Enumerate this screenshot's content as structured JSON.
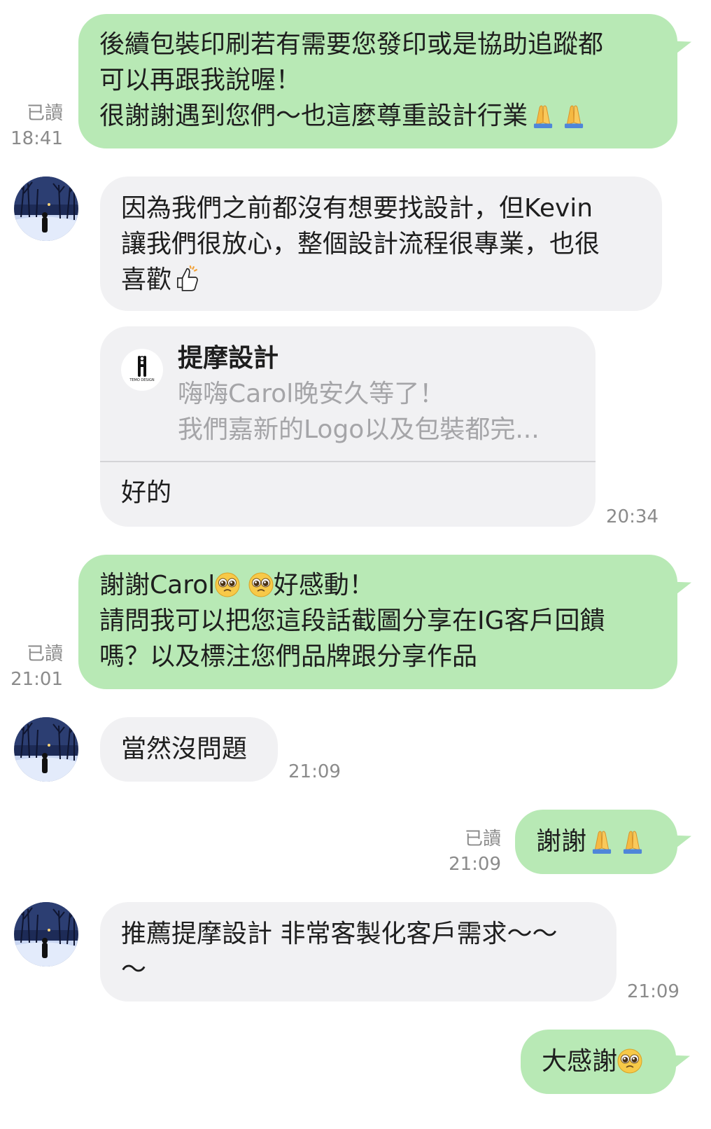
{
  "messages": [
    {
      "id": "m1",
      "lines": [
        "後續包裝印刷若有需要您發印或是協助追蹤都",
        "可以再跟我說喔！",
        "很謝謝遇到您們～也這麼尊重設計行業"
      ],
      "read": "已讀",
      "time": "18:41"
    },
    {
      "id": "m2",
      "lines": [
        "因為我們之前都沒有想要找設計，但Kevin",
        "讓我們很放心，整個設計流程很專業，也很",
        "喜歡"
      ]
    },
    {
      "id": "m3",
      "quote_name": "提摩設計",
      "quote_lines": [
        "嗨嗨Carol晚安久等了！",
        "我們嘉新的Logo以及包裝都完..."
      ],
      "quote_logo_text": "TEMO DESIGN",
      "text": "好的",
      "time": "20:34"
    },
    {
      "id": "m4",
      "line1a": "謝謝Carol",
      "line1b": "好感動！",
      "lines": [
        "請問我可以把您這段話截圖分享在IG客戶回饋",
        "嗎？以及標注您們品牌跟分享作品"
      ],
      "read": "已讀",
      "time": "21:01"
    },
    {
      "id": "m5",
      "text": "當然沒問題",
      "time": "21:09"
    },
    {
      "id": "m6",
      "text": "謝謝",
      "read": "已讀",
      "time": "21:09"
    },
    {
      "id": "m7",
      "lines": [
        "推薦提摩設計 非常客製化客戶需求～～",
        "～"
      ],
      "time": "21:09"
    },
    {
      "id": "m8",
      "text": "大感謝"
    }
  ]
}
